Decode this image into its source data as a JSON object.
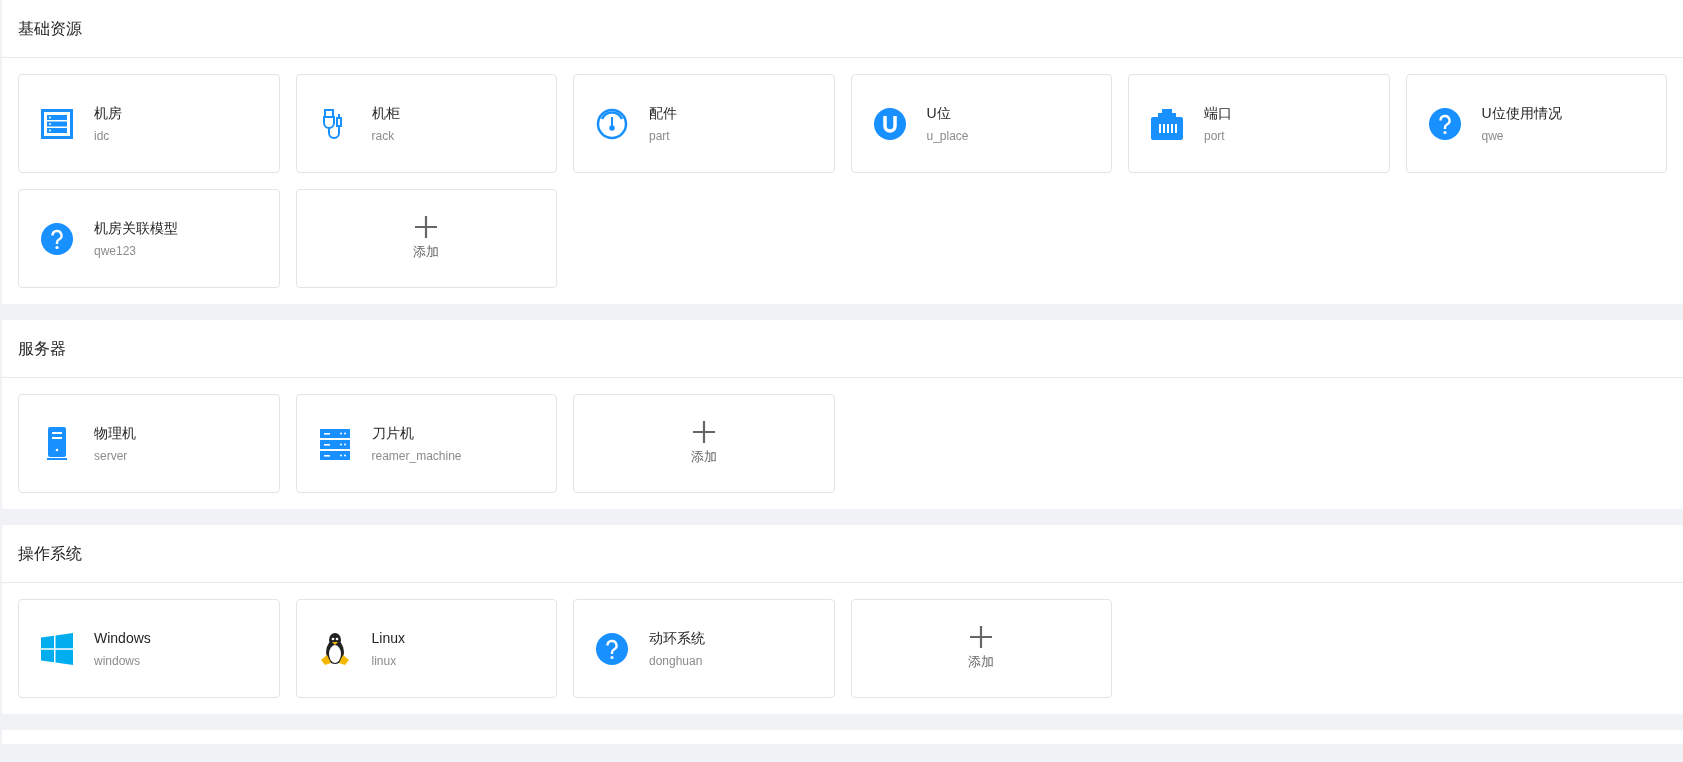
{
  "sections": [
    {
      "title": "基础资源",
      "cards": [
        {
          "kind": "rack-list",
          "name": "机房",
          "code": "idc"
        },
        {
          "kind": "usb",
          "name": "机柜",
          "code": "rack"
        },
        {
          "kind": "gauge",
          "name": "配件",
          "code": "part"
        },
        {
          "kind": "u-circle",
          "name": "U位",
          "code": "u_place"
        },
        {
          "kind": "port",
          "name": "端口",
          "code": "port"
        },
        {
          "kind": "question",
          "name": "U位使用情况",
          "code": "qwe"
        },
        {
          "kind": "question",
          "name": "机房关联模型",
          "code": "qwe123"
        },
        {
          "kind": "add",
          "label": "添加"
        }
      ]
    },
    {
      "title": "服务器",
      "cards": [
        {
          "kind": "tower",
          "name": "物理机",
          "code": "server"
        },
        {
          "kind": "blade",
          "name": "刀片机",
          "code": "reamer_machine"
        },
        {
          "kind": "add",
          "label": "添加"
        }
      ]
    },
    {
      "title": "操作系统",
      "cards": [
        {
          "kind": "windows",
          "name": "Windows",
          "code": "windows"
        },
        {
          "kind": "penguin",
          "name": "Linux",
          "code": "linux"
        },
        {
          "kind": "question",
          "name": "动环系统",
          "code": "donghuan"
        },
        {
          "kind": "add",
          "label": "添加"
        }
      ]
    }
  ]
}
